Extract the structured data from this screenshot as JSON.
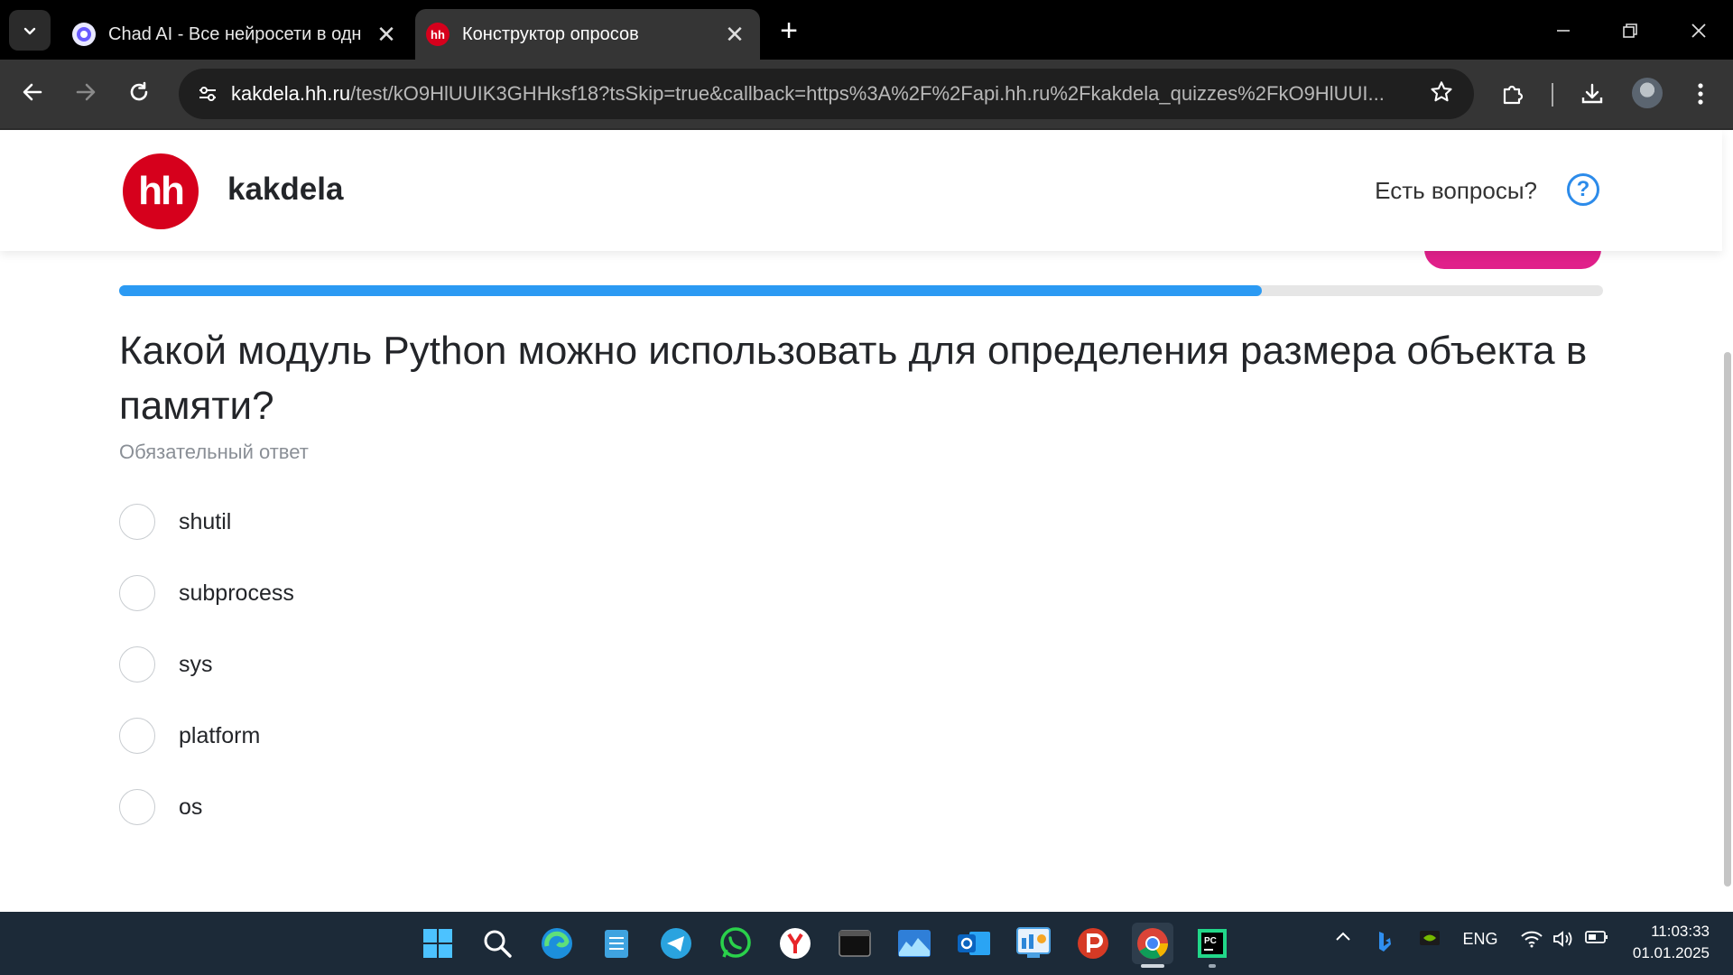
{
  "browser": {
    "tabs": [
      {
        "title": "Chad AI - Все нейросети в одн",
        "active": false,
        "favicon": "chad-ai-icon"
      },
      {
        "title": "Конструктор опросов",
        "active": true,
        "favicon": "hh-icon",
        "favicon_text": "hh"
      }
    ],
    "url_host": "kakdela.hh.ru",
    "url_path": "/test/kO9HlUUIK3GHHksf18?tsSkip=true&callback=https%3A%2F%2Fapi.hh.ru%2Fkakdela_quizzes%2FkO9HlUUI..."
  },
  "site": {
    "logo_text": "hh",
    "brand": "kakdela",
    "help_text": "Есть вопросы?",
    "help_icon_glyph": "?"
  },
  "quiz": {
    "progress_percent": 77,
    "question": "Какой модуль Python можно использовать для определения размера объекта в памяти?",
    "required_label": "Обязательный ответ",
    "options": [
      {
        "label": "shutil",
        "selected": false
      },
      {
        "label": "subprocess",
        "selected": false
      },
      {
        "label": "sys",
        "selected": false
      },
      {
        "label": "platform",
        "selected": false
      },
      {
        "label": "os",
        "selected": false
      }
    ]
  },
  "taskbar": {
    "apps": [
      "windows-start-icon",
      "search-icon",
      "edge-icon",
      "notepad-icon",
      "telegram-icon",
      "whatsapp-icon",
      "yandex-browser-icon",
      "terminal-icon",
      "photos-icon",
      "outlook-icon",
      "dashboard-app-icon",
      "psiphon-icon",
      "chrome-icon",
      "pycharm-icon"
    ],
    "language": "ENG",
    "time": "11:03:33",
    "date": "01.01.2025"
  },
  "colors": {
    "accent_blue": "#2b9af3",
    "hh_red": "#d6001c",
    "pink": "#e0208a"
  }
}
